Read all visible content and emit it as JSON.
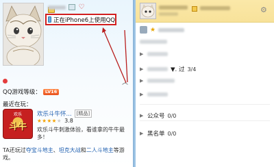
{
  "profile_card": {
    "device_status": "正在iPhone6上使用QQ",
    "qq_level_label": "QQ游戏等级：",
    "level_badge": "LV16",
    "expand_icon": "chevron-up-icon",
    "recent_label": "最近在玩：",
    "game": {
      "icon_top": "欢乐",
      "icon_text": "斗牛",
      "title": "欢乐斗牛怀...",
      "tag": "[精品]",
      "rating": "3.8",
      "rating_value": 3.8,
      "description": "欢乐斗牛刺激体验，看谁拿的牛牛最多！"
    },
    "played": {
      "prefix": "TA还玩过",
      "game1": "夺宝斗地主",
      "sep1": "、",
      "game2": "坦克大战",
      "sep2": "和",
      "game3": "二人斗地主",
      "suffix": "等游戏。"
    }
  },
  "contacts_panel": {
    "settings_icon": "gear-icon",
    "groups": [
      {
        "label": "",
        "count": ""
      },
      {
        "label": "",
        "count": ""
      },
      {
        "label": "▼. 过",
        "count": "3/4"
      },
      {
        "label": "",
        "count": ""
      },
      {
        "label": "",
        "count": ""
      },
      {
        "label": "公众号",
        "count": "0/0"
      },
      {
        "label": "黑名单",
        "count": "0/0"
      }
    ]
  },
  "colors": {
    "highlight_box": "#d21e1e",
    "arrow": "#b81d1d",
    "header_bg": "#f8e29a",
    "link": "#1f5fb0"
  }
}
